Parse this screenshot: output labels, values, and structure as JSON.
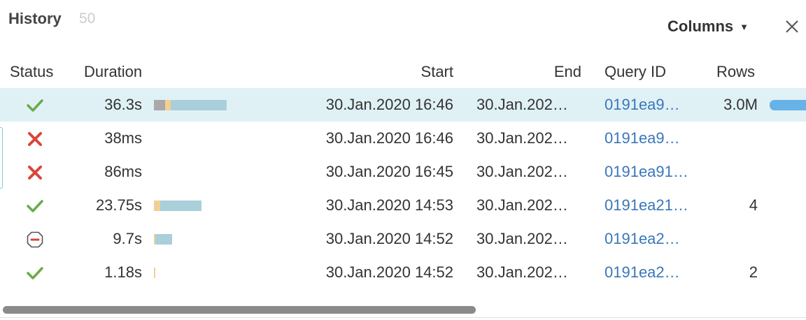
{
  "header": {
    "title": "History",
    "count": "50",
    "columns_label": "Columns"
  },
  "columns": {
    "status": "Status",
    "duration": "Duration",
    "start": "Start",
    "end": "End",
    "query_id": "Query ID",
    "rows": "Rows"
  },
  "colors": {
    "success": "#6aab4a",
    "error": "#d9463a",
    "cancelled": "#d9463a",
    "link": "#3a77b8",
    "selected_row": "#e0f1f6",
    "bar_gray": "#a9a9a9",
    "bar_amber": "#f2cf95",
    "bar_blue": "#a9cfda",
    "rows_bar": "#67b2e6"
  },
  "history": [
    {
      "status": "success",
      "status_icon": "check-icon",
      "duration": "36.3s",
      "start": "30.Jan.2020 16:46",
      "end": "30.Jan.202…",
      "query_id": "0191ea9…",
      "rows": "3.0M",
      "selected": true
    },
    {
      "status": "error",
      "status_icon": "cross-icon",
      "duration": "38ms",
      "start": "30.Jan.2020 16:46",
      "end": "30.Jan.202…",
      "query_id": "0191ea9…",
      "rows": ""
    },
    {
      "status": "error",
      "status_icon": "cross-icon",
      "duration": "86ms",
      "start": "30.Jan.2020 16:45",
      "end": "30.Jan.202…",
      "query_id": "0191ea91…",
      "rows": ""
    },
    {
      "status": "success",
      "status_icon": "check-icon",
      "duration": "23.75s",
      "start": "30.Jan.2020 14:53",
      "end": "30.Jan.202…",
      "query_id": "0191ea21…",
      "rows": "4"
    },
    {
      "status": "cancelled",
      "status_icon": "stop-icon",
      "duration": "9.7s",
      "start": "30.Jan.2020 14:52",
      "end": "30.Jan.202…",
      "query_id": "0191ea2…",
      "rows": ""
    },
    {
      "status": "success",
      "status_icon": "check-icon",
      "duration": "1.18s",
      "start": "30.Jan.2020 14:52",
      "end": "30.Jan.202…",
      "query_id": "0191ea2…",
      "rows": "2"
    }
  ]
}
